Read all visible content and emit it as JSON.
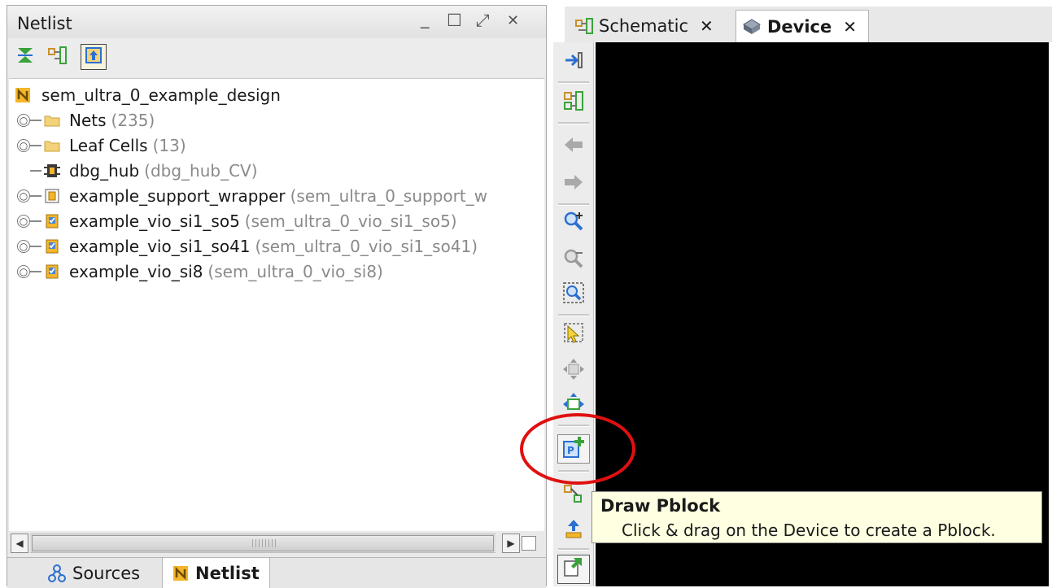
{
  "netlist_panel": {
    "title": "Netlist",
    "controls": {
      "minimize": "_",
      "maximize": "☐",
      "float": "⤢",
      "close": "✕"
    },
    "toolbar": [
      "collapse-all-icon",
      "show-hierarchy-icon",
      "auto-expand-icon"
    ],
    "tree": [
      {
        "name": "sem_ultra_0_example_design",
        "detail": "",
        "icon": "netlist-root-icon",
        "level": 0,
        "expandable": false
      },
      {
        "name": "Nets",
        "detail": "(235)",
        "icon": "folder-icon",
        "level": 1,
        "expandable": true
      },
      {
        "name": "Leaf Cells",
        "detail": "(13)",
        "icon": "folder-icon",
        "level": 1,
        "expandable": true
      },
      {
        "name": "dbg_hub",
        "detail": "(dbg_hub_CV)",
        "icon": "black-box-icon",
        "level": 1,
        "expandable": false
      },
      {
        "name": "example_support_wrapper",
        "detail": "(sem_ultra_0_support_w",
        "icon": "hier-cell-icon",
        "level": 1,
        "expandable": true
      },
      {
        "name": "example_vio_si1_so5",
        "detail": "(sem_ultra_0_vio_si1_so5)",
        "icon": "ip-cell-icon",
        "level": 1,
        "expandable": true
      },
      {
        "name": "example_vio_si1_so41",
        "detail": "(sem_ultra_0_vio_si1_so41)",
        "icon": "ip-cell-icon",
        "level": 1,
        "expandable": true
      },
      {
        "name": "example_vio_si8",
        "detail": "(sem_ultra_0_vio_si8)",
        "icon": "ip-cell-icon",
        "level": 1,
        "expandable": true
      }
    ],
    "bottom_tabs": [
      {
        "label": "Sources",
        "icon": "sources-icon",
        "active": false
      },
      {
        "label": "Netlist",
        "icon": "netlist-icon",
        "active": true
      }
    ]
  },
  "editor": {
    "tabs": [
      {
        "label": "Schematic",
        "icon": "schematic-icon",
        "active": false,
        "close": "✕"
      },
      {
        "label": "Device",
        "icon": "device-icon",
        "active": true,
        "close": "✕"
      }
    ],
    "device_toolbar": [
      "previous-view-icon",
      "schematic-view-icon",
      "back-arrow-icon",
      "forward-arrow-icon",
      "zoom-in-icon",
      "zoom-out-icon",
      "zoom-fit-icon",
      "select-arrow-icon",
      "move-icon",
      "resize-icon",
      "draw-pblock-icon",
      "route-icon",
      "place-icon",
      "autofit-icon"
    ]
  },
  "tooltip": {
    "title": "Draw Pblock",
    "body": "Click & drag on the Device to create a Pblock."
  },
  "colors": {
    "highlight": "#e01010",
    "tooltip_bg": "#ffffe1",
    "canvas": "#000000",
    "folder": "#f3d27a",
    "detail_text": "#8a8a8a"
  }
}
